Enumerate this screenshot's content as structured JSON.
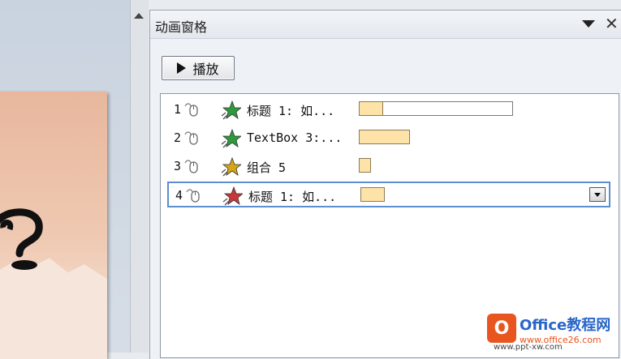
{
  "pane": {
    "title": "动画窗格",
    "close_glyph": "✕",
    "play_label": "播放"
  },
  "animations": [
    {
      "index": "1",
      "label": "标题 1: 如...",
      "effect_color": "#2e9a3c",
      "trigger": "on-click",
      "track": true,
      "start": 0.0,
      "duration": 0.16
    },
    {
      "index": "2",
      "label": "TextBox 3:...",
      "effect_color": "#2e9a3c",
      "trigger": "on-click",
      "track": false,
      "start": 0.0,
      "duration": 0.33
    },
    {
      "index": "3",
      "label": "组合 5",
      "effect_color": "#d6a419",
      "trigger": "on-click",
      "track": false,
      "start": 0.0,
      "duration": 0.08
    },
    {
      "index": "4",
      "label": "标题 1: 如...",
      "effect_color": "#c8383a",
      "trigger": "on-click",
      "track": false,
      "start": 0.0,
      "duration": 0.16,
      "selected": true
    }
  ],
  "watermark": {
    "logo_letter": "O",
    "title": "Office教程网",
    "url": "www.office26.com",
    "url2": "www.ppt-xw.com"
  }
}
